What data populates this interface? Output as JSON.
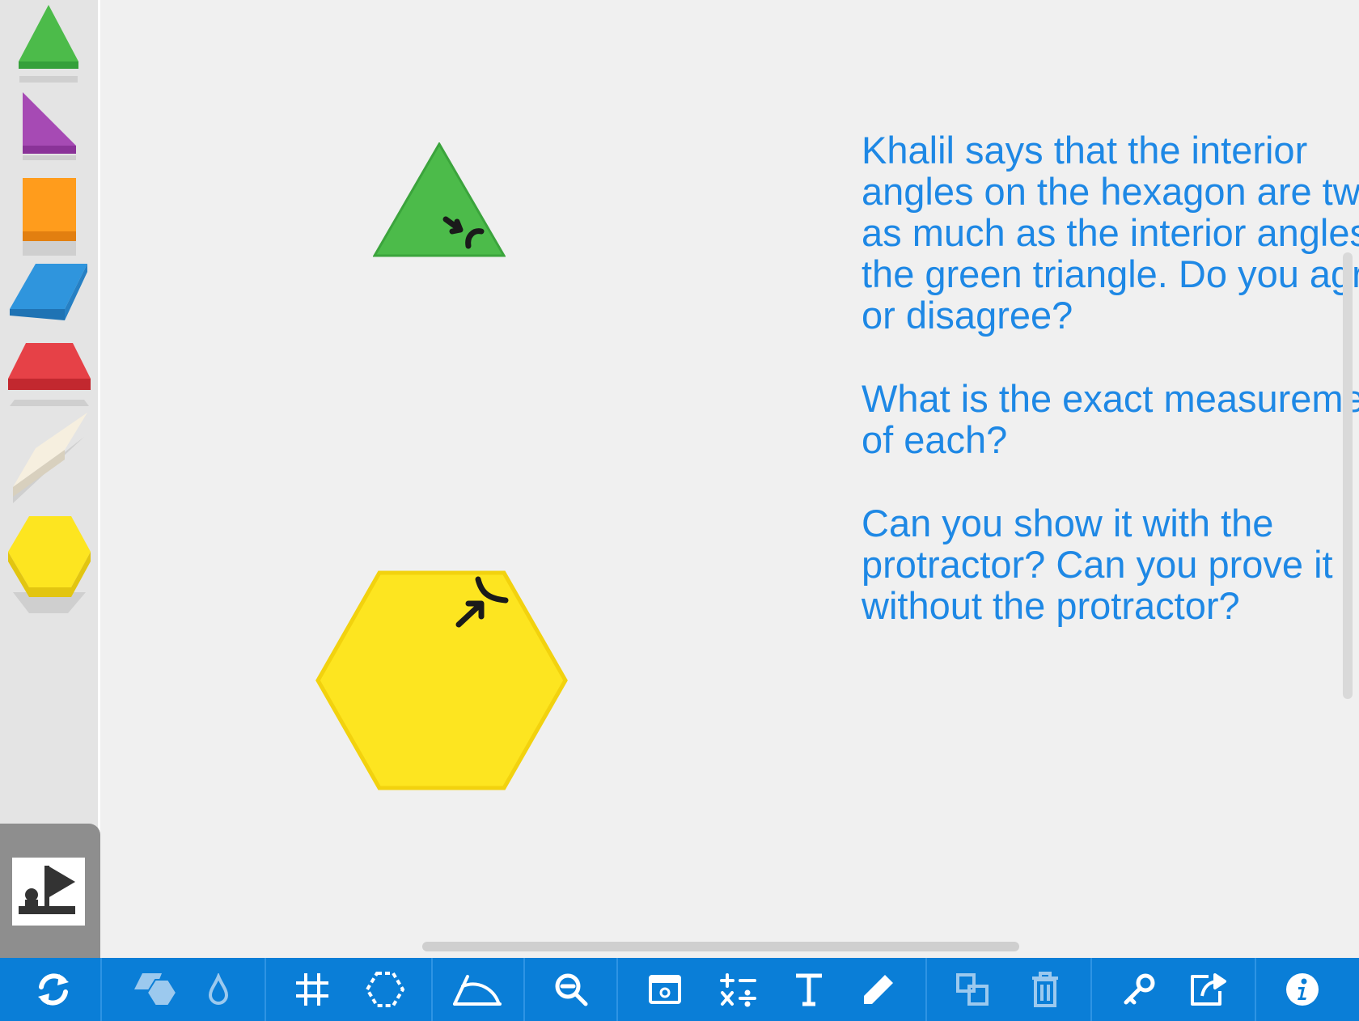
{
  "prompt": {
    "paragraphs": [
      "Khalil says that the interior angles on the hexagon are twice as much as the interior angles on the green triangle. Do you agree or disagree?",
      "What is the exact measurement of each?",
      "Can you show it with the protractor? Can you prove it without the protractor?"
    ]
  },
  "palette": {
    "shapes": [
      "green-triangle",
      "purple-right-triangle",
      "orange-square",
      "blue-rhombus",
      "red-trapezoid",
      "tan-thin-rhombus",
      "yellow-hexagon"
    ]
  },
  "colors": {
    "prompt_text": "#1e88e5",
    "toolbar": "#0a7ed7",
    "green": "#4cbb4a",
    "purple": "#a64ab4",
    "orange": "#ff9c1c",
    "blue": "#2f95dd",
    "red": "#e64147",
    "tan": "#f6efdf",
    "yellow": "#fde520"
  },
  "toolbar": {
    "tools": [
      "refresh-icon",
      "shapes-icon",
      "color-drop-icon",
      "grid-icon",
      "hexagon-select-icon",
      "protractor-icon",
      "zoom-out-icon",
      "image-icon",
      "math-symbols-icon",
      "text-icon",
      "pencil-icon",
      "duplicate-icon",
      "trash-icon",
      "key-icon",
      "share-icon",
      "info-icon"
    ]
  }
}
